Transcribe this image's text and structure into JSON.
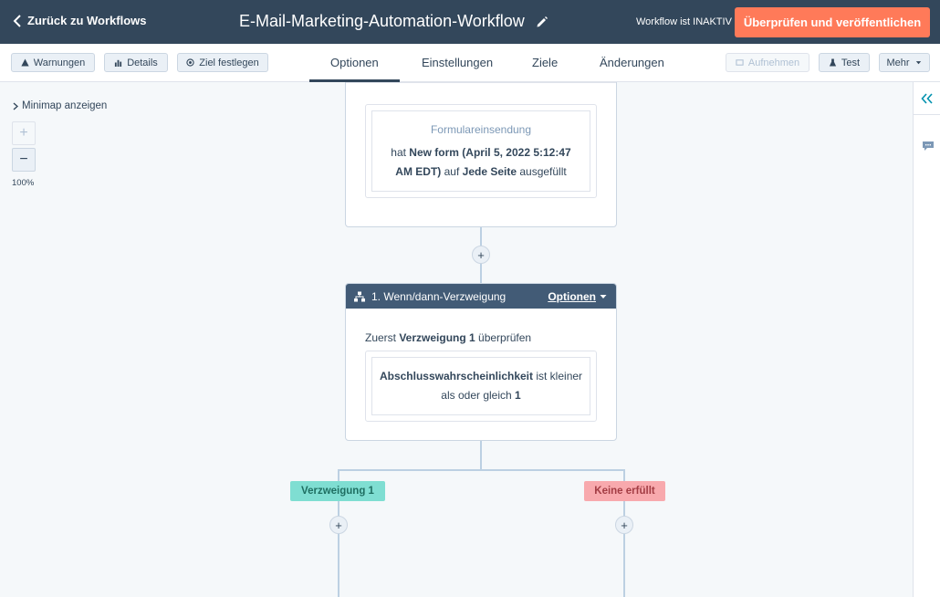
{
  "topbar": {
    "back_label": "Zurück zu Workflows",
    "title": "E-Mail-Marketing-Automation-Workflow",
    "status": "Workflow ist INAKTIV",
    "publish_label": "Überprüfen und veröffentlichen"
  },
  "toolbar": {
    "warnings_label": "Warnungen",
    "details_label": "Details",
    "goal_label": "Ziel festlegen",
    "tabs": [
      {
        "label": "Optionen",
        "active": true
      },
      {
        "label": "Einstellungen",
        "active": false
      },
      {
        "label": "Ziele",
        "active": false
      },
      {
        "label": "Änderungen",
        "active": false
      }
    ],
    "record_label": "Aufnehmen",
    "test_label": "Test",
    "more_label": "Mehr"
  },
  "canvas": {
    "minimap_label": "Minimap anzeigen",
    "zoom_in": "+",
    "zoom_out": "−",
    "zoom_level": "100%"
  },
  "trigger": {
    "label": "Formulareinsendung",
    "prefix": "hat ",
    "form_name": "New form (April 5, 2022 5:12:47",
    "form_name_2": "AM EDT)",
    "middle": " auf ",
    "page": "Jede Seite",
    "suffix": " ausgefüllt"
  },
  "branch": {
    "title": "1. Wenn/dann-Verzweigung",
    "options_label": "Optionen",
    "check_prefix": "Zuerst ",
    "check_branch": "Verzweigung 1",
    "check_suffix": " überprüfen",
    "condition_property": "Abschlusswahrscheinlichkeit",
    "condition_op_1": " ist kleiner",
    "condition_op_2": "als oder gleich ",
    "condition_value": "1"
  },
  "branches": {
    "yes_label": "Verzweigung 1",
    "none_label": "Keine erfüllt"
  },
  "plus_label": "+",
  "colors": {
    "topbar": "#33475b",
    "publish": "#ff7a59",
    "branch_green": "#7fded2",
    "branch_red": "#f8a9ad"
  }
}
